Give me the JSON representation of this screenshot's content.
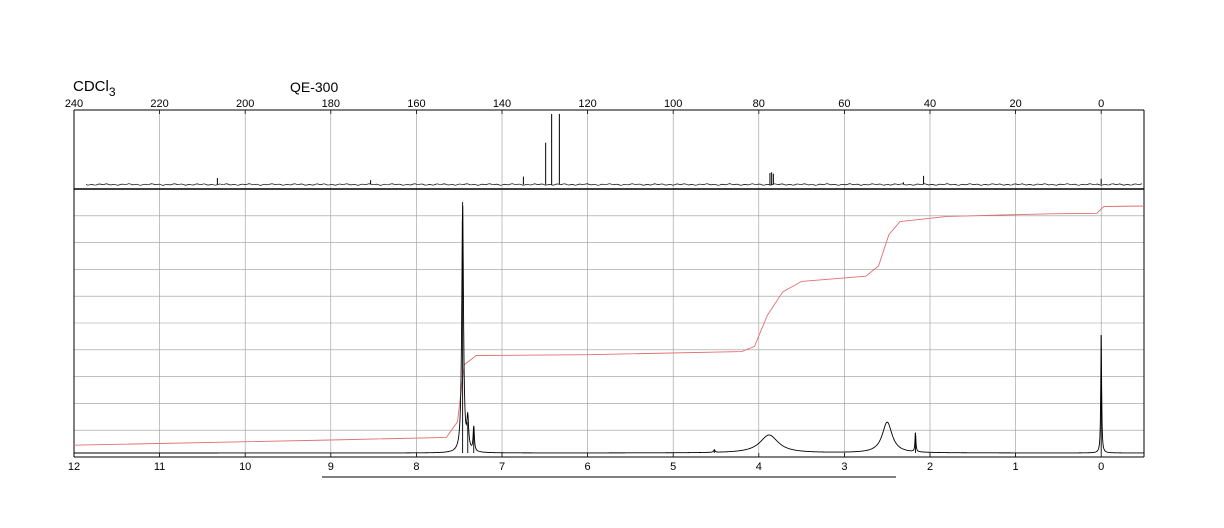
{
  "header": {
    "solvent_main": "CDCl",
    "solvent_sub": "3",
    "instrument": "QE-300"
  },
  "chart_data": [
    {
      "type": "line",
      "name": "13C NMR spectrum",
      "xlim": [
        240,
        -10
      ],
      "ticks": [
        "240",
        "220",
        "200",
        "180",
        "160",
        "140",
        "120",
        "100",
        "80",
        "60",
        "40",
        "20",
        "0"
      ],
      "tick_values": [
        240,
        220,
        200,
        180,
        160,
        140,
        120,
        100,
        80,
        60,
        40,
        20,
        0
      ],
      "grid": true,
      "peaks": [
        {
          "x": 206.5,
          "h": 0.09
        },
        {
          "x": 170.7,
          "h": 0.06
        },
        {
          "x": 135.0,
          "h": 0.11
        },
        {
          "x": 129.8,
          "h": 0.58
        },
        {
          "x": 128.4,
          "h": 0.98
        },
        {
          "x": 126.6,
          "h": 0.98
        },
        {
          "x": 77.4,
          "h": 0.16
        },
        {
          "x": 77.0,
          "h": 0.17
        },
        {
          "x": 76.6,
          "h": 0.15
        },
        {
          "x": 46.2,
          "h": 0.03
        },
        {
          "x": 41.5,
          "h": 0.12
        },
        {
          "x": 0.0,
          "h": 0.08
        }
      ],
      "colors": {
        "spectrum": "#000000",
        "grid": "#9a9a9a"
      }
    },
    {
      "type": "line",
      "name": "1H NMR spectrum",
      "xlim": [
        12,
        -0.5
      ],
      "ticks": [
        "12",
        "11",
        "10",
        "9",
        "8",
        "7",
        "6",
        "5",
        "4",
        "3",
        "2",
        "1",
        "0"
      ],
      "tick_values": [
        12,
        11,
        10,
        9,
        8,
        7,
        6,
        5,
        4,
        3,
        2,
        1,
        0
      ],
      "grid": true,
      "peaks": [
        {
          "x": 7.46,
          "h": 0.98,
          "w": 0.012
        },
        {
          "x": 7.4,
          "h": 0.12,
          "w": 0.012
        },
        {
          "x": 7.33,
          "h": 0.1,
          "w": 0.008
        },
        {
          "x": 4.52,
          "h": 0.01,
          "w": 0.01
        },
        {
          "x": 3.88,
          "h": 0.07,
          "w": 0.13
        },
        {
          "x": 2.5,
          "h": 0.12,
          "w": 0.07
        },
        {
          "x": 2.17,
          "h": 0.08,
          "w": 0.006
        },
        {
          "x": 0.0,
          "h": 0.46,
          "w": 0.006
        }
      ],
      "integral": [
        [
          12.0,
          0.03
        ],
        [
          9.0,
          0.05
        ],
        [
          7.65,
          0.06
        ],
        [
          7.52,
          0.12
        ],
        [
          7.44,
          0.34
        ],
        [
          7.3,
          0.375
        ],
        [
          6.0,
          0.378
        ],
        [
          4.2,
          0.39
        ],
        [
          4.05,
          0.41
        ],
        [
          3.9,
          0.53
        ],
        [
          3.72,
          0.62
        ],
        [
          3.5,
          0.66
        ],
        [
          2.75,
          0.68
        ],
        [
          2.6,
          0.72
        ],
        [
          2.48,
          0.84
        ],
        [
          2.35,
          0.89
        ],
        [
          1.8,
          0.91
        ],
        [
          0.6,
          0.92
        ],
        [
          0.05,
          0.922
        ],
        [
          -0.03,
          0.948
        ],
        [
          -0.5,
          0.95
        ]
      ],
      "colors": {
        "spectrum": "#000000",
        "integral": "#e07070",
        "grid": "#9a9a9a"
      }
    }
  ]
}
